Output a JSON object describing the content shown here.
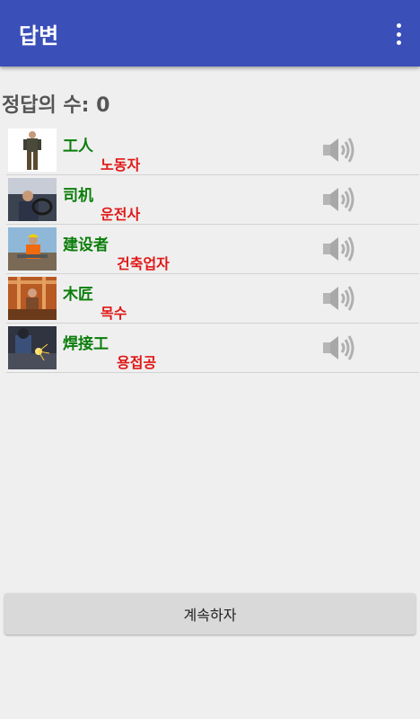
{
  "app_bar": {
    "title": "답변"
  },
  "score": {
    "label": "정답의 수: 0"
  },
  "words": [
    {
      "chinese": "工人",
      "korean": "노동자",
      "icon": "worker-photo"
    },
    {
      "chinese": "司机",
      "korean": "운전사",
      "icon": "driver-photo"
    },
    {
      "chinese": "建设者",
      "korean": "건축업자",
      "icon": "builder-photo"
    },
    {
      "chinese": "木匠",
      "korean": "목수",
      "icon": "carpenter-photo"
    },
    {
      "chinese": "焊接工",
      "korean": "용접공",
      "icon": "welder-photo"
    }
  ],
  "footer": {
    "continue_label": "계속하자"
  },
  "colors": {
    "app_bar": "#3a4fb8",
    "chinese_text": "#0b7d0b",
    "korean_text": "#e01818"
  }
}
